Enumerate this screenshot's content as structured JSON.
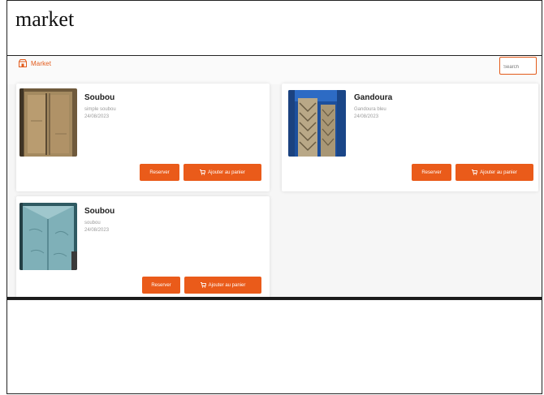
{
  "document": {
    "heading": "market"
  },
  "app": {
    "brand": "Market",
    "search": {
      "value": "",
      "placeholder": "Search"
    },
    "colors": {
      "accent": "#ea5b1a",
      "card_bg": "#ffffff",
      "page_bg": "#f6f6f6"
    },
    "products": [
      {
        "name": "Soubou",
        "description": "simple soubou",
        "date": "24/08/2023",
        "primary_label": "Reserver",
        "cart_label": "Ajouter au panier",
        "image": "beige-garment-photo"
      },
      {
        "name": "Gandoura",
        "description": "Gandoura bleu",
        "date": "24/08/2023",
        "primary_label": "Reserver",
        "cart_label": "Ajouter au panier",
        "image": "blue-embroidered-garment-photo"
      },
      {
        "name": "Soubou",
        "description": "soubou",
        "date": "24/08/2023",
        "primary_label": "Reserver",
        "cart_label": "Ajouter au panier",
        "image": "light-blue-garment-photo"
      }
    ]
  }
}
